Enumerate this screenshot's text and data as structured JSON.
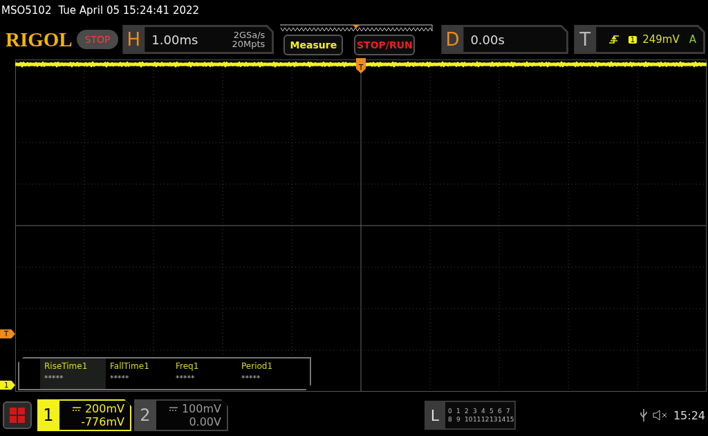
{
  "title_bar": {
    "model": "MSO5102",
    "datetime": "Tue April 05 15:24:41 2022"
  },
  "logo": "RIGOL",
  "run_state": "STOP",
  "horizontal": {
    "label": "H",
    "timebase": "1.00ms",
    "sample_rate": "2GSa/s",
    "memory_depth": "20Mpts"
  },
  "buttons": [
    {
      "label": "Measure",
      "kind": "menu"
    },
    {
      "label": "STOP/RUN",
      "kind": "run"
    }
  ],
  "delay": {
    "label": "D",
    "value": "0.00s"
  },
  "trigger": {
    "label": "T",
    "source": "1",
    "level": "249mV",
    "mode": "A"
  },
  "markers": [
    {
      "label": "T",
      "kind": "trigger"
    },
    {
      "label": "1",
      "kind": "channel"
    }
  ],
  "trigger_position_marker": {
    "label": "T"
  },
  "measurements": [
    {
      "name": "RiseTime1",
      "value": "*****",
      "selected": true
    },
    {
      "name": "FallTime1",
      "value": "*****",
      "selected": false
    },
    {
      "name": "Freq1",
      "value": "*****",
      "selected": false
    },
    {
      "name": "Period1",
      "value": "*****",
      "selected": false
    }
  ],
  "channels": [
    {
      "number": "1",
      "scale": "200mV",
      "offset": "-776mV",
      "selected": true
    },
    {
      "number": "2",
      "scale": "100mV",
      "offset": "0.00V",
      "selected": false
    }
  ],
  "logic": {
    "label": "L",
    "rows": [
      [
        "0",
        "1",
        "2",
        "3",
        "4",
        "5",
        "6",
        "7"
      ],
      [
        "8",
        "9",
        "10",
        "11",
        "12",
        "13",
        "14",
        "15"
      ]
    ]
  },
  "status": {
    "time": "15:24",
    "muted": true
  }
}
